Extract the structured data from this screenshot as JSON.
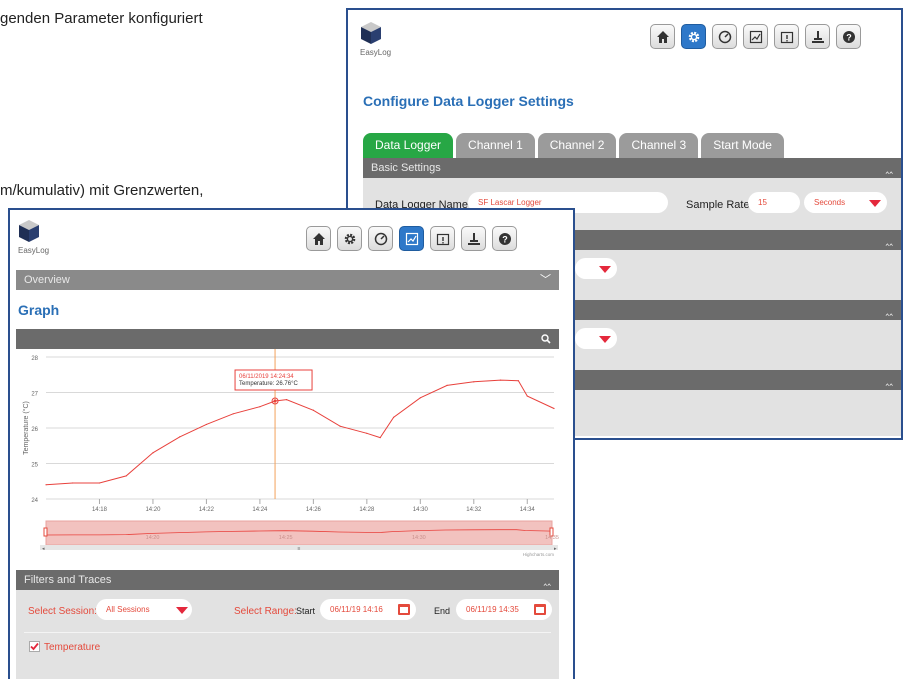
{
  "doc": {
    "line1": "genden Parameter konfiguriert",
    "line2": "m/kumulativ) mit Grenzwerten,"
  },
  "app": {
    "logo_text": "EasyLog"
  },
  "settings": {
    "title": "Configure Data Logger Settings",
    "tabs": [
      {
        "label": "Data Logger",
        "active": true
      },
      {
        "label": "Channel 1",
        "active": false
      },
      {
        "label": "Channel 2",
        "active": false
      },
      {
        "label": "Channel 3",
        "active": false
      },
      {
        "label": "Start Mode",
        "active": false
      }
    ],
    "basic_section": "Basic Settings",
    "name_label": "Data Logger Name",
    "name_value": "SF Lascar Logger",
    "rate_label": "Sample Rate",
    "rate_value": "15",
    "rate_unit": "Seconds"
  },
  "graph_page": {
    "overview_label": "Overview",
    "title": "Graph",
    "filters_title": "Filters and Traces",
    "select_session_label": "Select Session:",
    "session_value": "All Sessions",
    "select_range_label": "Select Range:",
    "start_label": "Start",
    "start_value": "06/11/19 14:16",
    "end_label": "End",
    "end_value": "06/11/19 14:35",
    "trace_label": "Temperature",
    "trace_checked": true
  },
  "chart_data": {
    "type": "line",
    "ylabel": "Temperature (°C)",
    "xlabel": "",
    "ylim": [
      24,
      28
    ],
    "y_ticks": [
      "28",
      "27",
      "26",
      "25",
      "24"
    ],
    "x_ticks": [
      "14:18",
      "14:20",
      "14:22",
      "14:24",
      "14:26",
      "14:28",
      "14:30",
      "14:32",
      "14:34"
    ],
    "navigator_ticks": [
      "14:20",
      "14:25",
      "14:30",
      "14:35"
    ],
    "credits": "Highcharts.com",
    "line_color": "#e8413c",
    "series": [
      {
        "values": [
          {
            "x": "14:16",
            "y": 24.4
          },
          {
            "x": "14:17",
            "y": 24.45
          },
          {
            "x": "14:18",
            "y": 24.45
          },
          {
            "x": "14:19",
            "y": 24.65
          },
          {
            "x": "14:20",
            "y": 25.3
          },
          {
            "x": "14:21",
            "y": 25.75
          },
          {
            "x": "14:22",
            "y": 26.1
          },
          {
            "x": "14:23",
            "y": 26.4
          },
          {
            "x": "14:24",
            "y": 26.6
          },
          {
            "x": "14:24:34",
            "y": 26.76
          },
          {
            "x": "14:25",
            "y": 26.8
          },
          {
            "x": "14:26",
            "y": 26.5
          },
          {
            "x": "14:27",
            "y": 26.05
          },
          {
            "x": "14:28",
            "y": 25.85
          },
          {
            "x": "14:28:30",
            "y": 25.73
          },
          {
            "x": "14:29",
            "y": 26.3
          },
          {
            "x": "14:30",
            "y": 26.85
          },
          {
            "x": "14:31",
            "y": 27.2
          },
          {
            "x": "14:32",
            "y": 27.3
          },
          {
            "x": "14:33",
            "y": 27.35
          },
          {
            "x": "14:33:40",
            "y": 27.33
          },
          {
            "x": "14:34",
            "y": 26.9
          },
          {
            "x": "14:35",
            "y": 26.55
          }
        ]
      }
    ],
    "tooltip": {
      "x": "14:24:34",
      "y": 26.76,
      "date_line": "06/11/2019 14:24:34",
      "value_line": "Temperature: 26.76°C"
    }
  }
}
